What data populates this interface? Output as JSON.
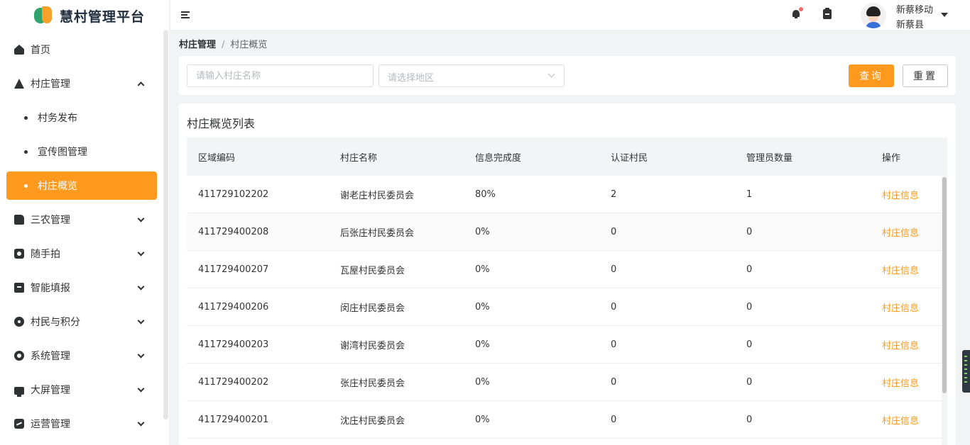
{
  "app": {
    "title": "慧村管理平台"
  },
  "sidebar": {
    "items": [
      {
        "label": "首页",
        "icon": "home-icon"
      },
      {
        "label": "村庄管理",
        "icon": "triangle-icon",
        "expanded": true,
        "children": [
          {
            "label": "村务发布"
          },
          {
            "label": "宣传图管理"
          },
          {
            "label": "村庄概览",
            "active": true
          }
        ]
      },
      {
        "label": "三农管理",
        "icon": "document-icon"
      },
      {
        "label": "随手拍",
        "icon": "camera-icon"
      },
      {
        "label": "智能填报",
        "icon": "clipboard-icon"
      },
      {
        "label": "村民与积分",
        "icon": "circle-icon"
      },
      {
        "label": "系统管理",
        "icon": "gear-icon"
      },
      {
        "label": "大屏管理",
        "icon": "screen-icon"
      },
      {
        "label": "运营管理",
        "icon": "chart-icon"
      }
    ]
  },
  "header": {
    "user_name": "新蔡移动",
    "user_org": "新蔡县"
  },
  "breadcrumb": {
    "parent": "村庄管理",
    "separator": "/",
    "current": "村庄概览"
  },
  "search": {
    "name_placeholder": "请输入村庄名称",
    "region_placeholder": "请选择地区",
    "query_label": "查询",
    "reset_label": "重置"
  },
  "table": {
    "title": "村庄概览列表",
    "columns": [
      "区域编码",
      "村庄名称",
      "信息完成度",
      "认证村民",
      "管理员数量",
      "操作"
    ],
    "rows": [
      {
        "code": "411729102202",
        "name": "谢老庄村民委员会",
        "completion": "80%",
        "verified": "2",
        "admins": "1",
        "action": "村庄信息"
      },
      {
        "code": "411729400208",
        "name": "后张庄村民委员会",
        "completion": "0%",
        "verified": "0",
        "admins": "0",
        "action": "村庄信息"
      },
      {
        "code": "411729400207",
        "name": "瓦屋村民委员会",
        "completion": "0%",
        "verified": "0",
        "admins": "0",
        "action": "村庄信息"
      },
      {
        "code": "411729400206",
        "name": "闵庄村民委员会",
        "completion": "0%",
        "verified": "0",
        "admins": "0",
        "action": "村庄信息"
      },
      {
        "code": "411729400203",
        "name": "谢湾村民委员会",
        "completion": "0%",
        "verified": "0",
        "admins": "0",
        "action": "村庄信息"
      },
      {
        "code": "411729400202",
        "name": "张庄村民委员会",
        "completion": "0%",
        "verified": "0",
        "admins": "0",
        "action": "村庄信息"
      },
      {
        "code": "411729400201",
        "name": "沈庄村民委员会",
        "completion": "0%",
        "verified": "0",
        "admins": "0",
        "action": "村庄信息"
      }
    ]
  },
  "colors": {
    "accent": "#ff9a1f",
    "brand_green": "#2ea36b"
  }
}
